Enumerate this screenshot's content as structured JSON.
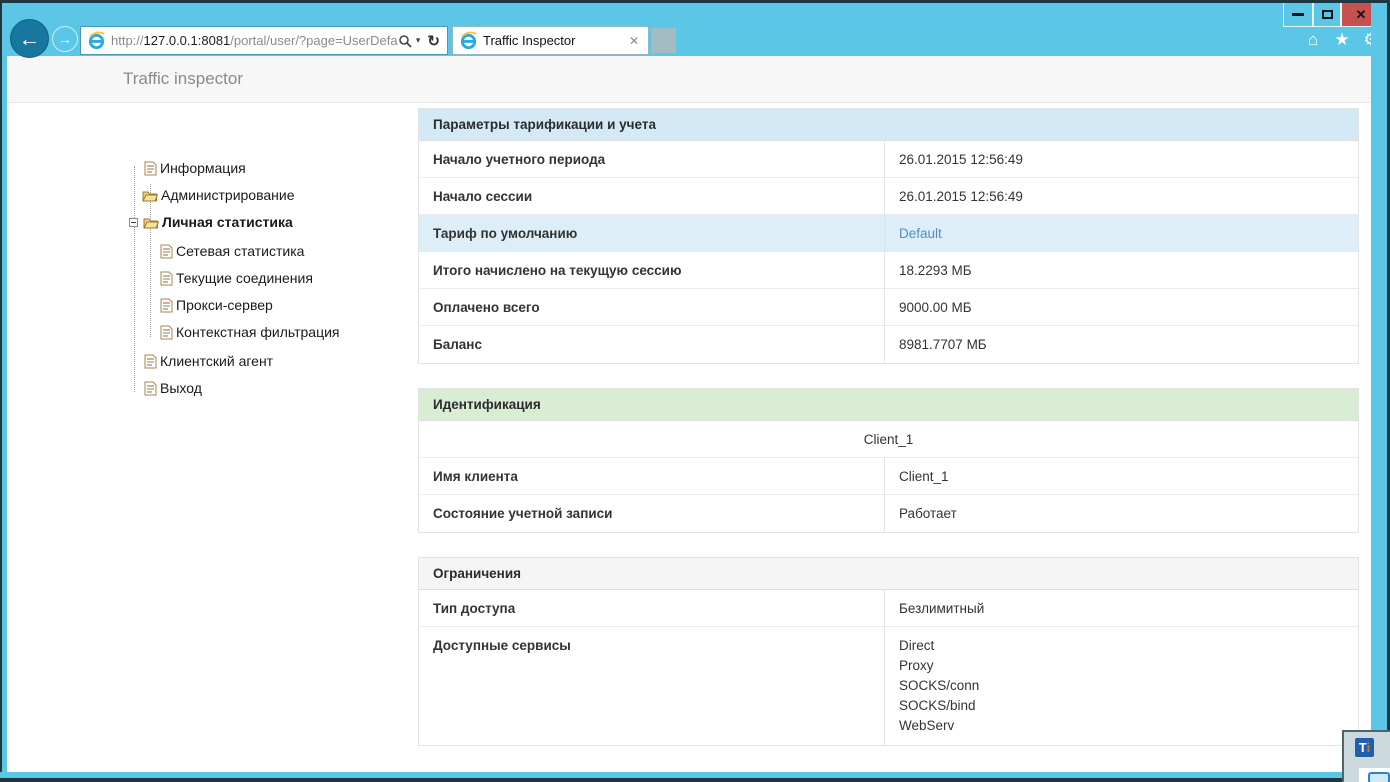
{
  "browser": {
    "url_scheme": "http://",
    "url_host": "127.0.0.1:8081",
    "url_path": "/portal/user/?page=UserDefault",
    "tab_title": "Traffic Inspector",
    "icons": {
      "back": "←",
      "forward": "→",
      "caret": "▾",
      "refresh": "↻",
      "tab_close": "✕",
      "home": "⌂",
      "star": "★",
      "gear": "⚙",
      "close": "✕"
    }
  },
  "page": {
    "header_title": "Traffic inspector"
  },
  "sidebar": {
    "items": [
      {
        "label": "Информация",
        "icon": "document"
      },
      {
        "label": "Администрирование",
        "icon": "folder"
      },
      {
        "label": "Личная статистика",
        "icon": "folder",
        "bold": true,
        "expanded": true
      },
      {
        "label": "Сетевая статистика",
        "icon": "document"
      },
      {
        "label": "Текущие соединения",
        "icon": "document"
      },
      {
        "label": "Прокси-сервер",
        "icon": "document"
      },
      {
        "label": "Контекстная фильтрация",
        "icon": "document"
      },
      {
        "label": "Клиентский агент",
        "icon": "document"
      },
      {
        "label": "Выход",
        "icon": "document"
      }
    ]
  },
  "tables": {
    "tariff": {
      "title": "Параметры тарификации и учета",
      "header_bg": "#d3eaf6",
      "rows": [
        {
          "label": "Начало учетного периода",
          "value": "26.01.2015 12:56:49"
        },
        {
          "label": "Начало сессии",
          "value": "26.01.2015 12:56:49"
        },
        {
          "label": "Тариф по умолчанию",
          "value": "Default",
          "is_link": true,
          "highlighted": true
        },
        {
          "label": "Итого начислено на текущую сессию",
          "value": "18.2293 МБ"
        },
        {
          "label": "Оплачено всего",
          "value": "9000.00 МБ"
        },
        {
          "label": "Баланс",
          "value": "8981.7707 МБ"
        }
      ]
    },
    "identification": {
      "title": "Идентификация",
      "header_bg": "#d9ecd4",
      "banner": "Client_1",
      "rows": [
        {
          "label": "Имя клиента",
          "value": "Client_1"
        },
        {
          "label": "Состояние учетной записи",
          "value": "Работает"
        }
      ]
    },
    "restrictions": {
      "title": "Ограничения",
      "header_bg": "#f5f5f5",
      "rows": [
        {
          "label": "Тип доступа",
          "value": "Безлимитный"
        },
        {
          "label": "Доступные сервисы",
          "value_lines": [
            "Direct",
            "Proxy",
            "SOCKS/conn",
            "SOCKS/bind",
            "WebServ"
          ]
        }
      ]
    }
  },
  "overlay": {
    "logo_t": "T",
    "logo_i": "i"
  }
}
